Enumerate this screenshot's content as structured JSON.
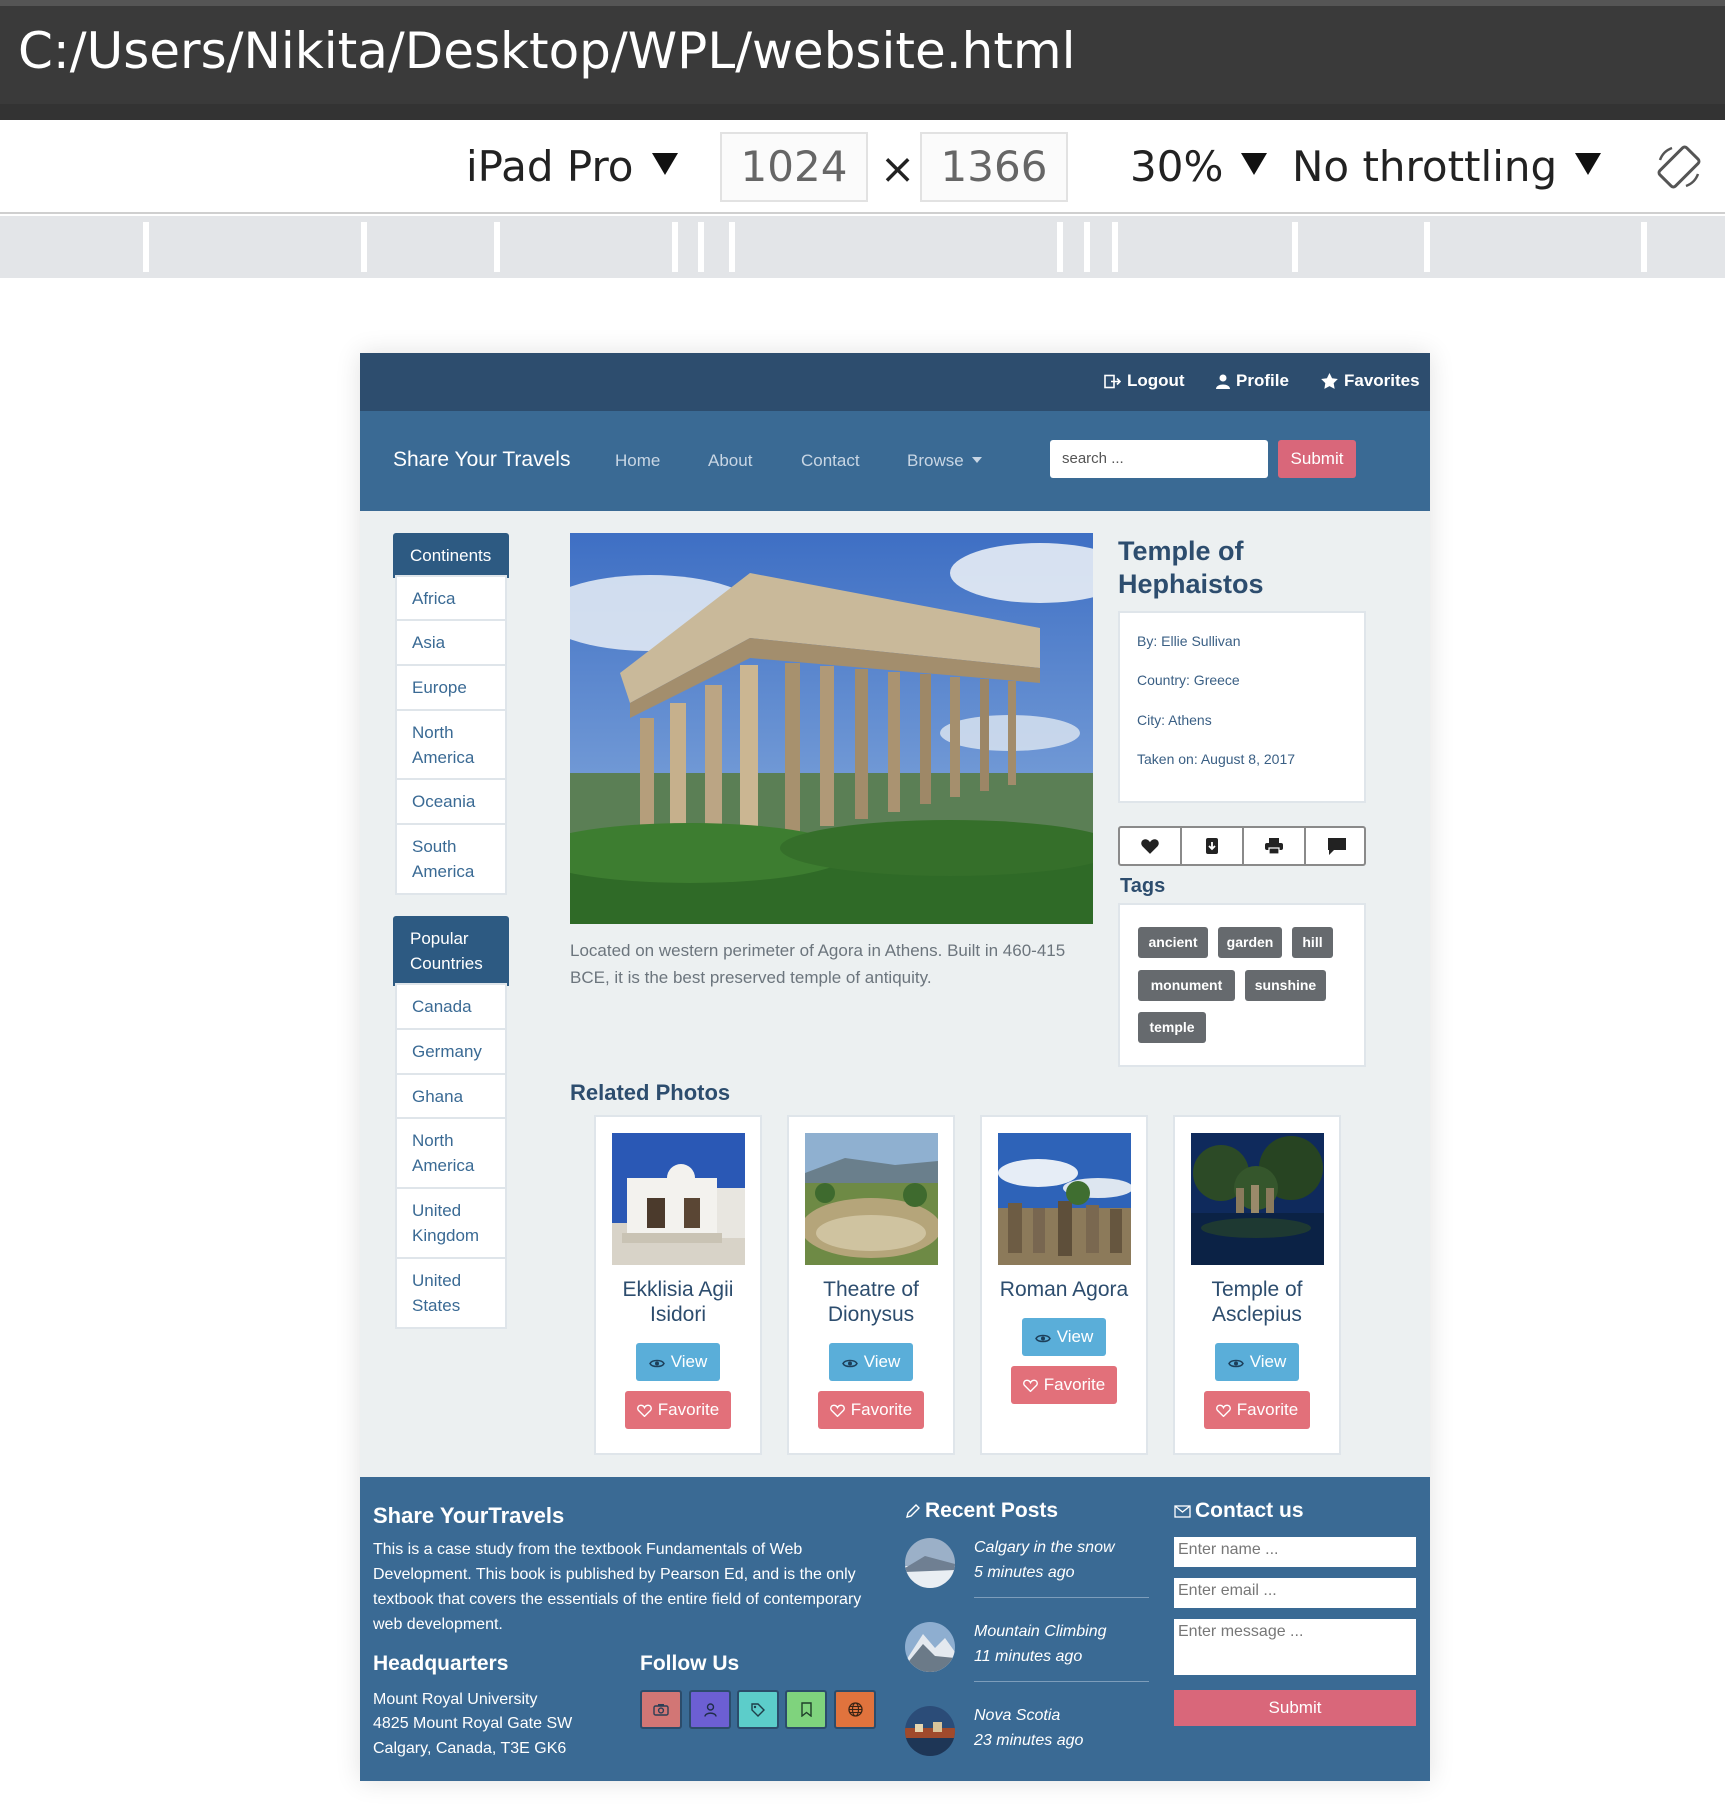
{
  "window": {
    "path": "C:/Users/Nikita/Desktop/WPL/website.html"
  },
  "devtools": {
    "device": "iPad Pro",
    "width": "1024",
    "times": "×",
    "height": "1366",
    "zoom": "30%",
    "throttling": "No throttling"
  },
  "site": {
    "topbar": {
      "logout": "Logout",
      "profile": "Profile",
      "favorites": "Favorites"
    },
    "nav": {
      "brand": "Share Your Travels",
      "items": [
        "Home",
        "About",
        "Contact",
        "Browse"
      ],
      "search_placeholder": "search ...",
      "submit": "Submit"
    },
    "sidebar": {
      "continents_title": "Continents",
      "continents": [
        "Africa",
        "Asia",
        "Europe",
        "North America",
        "Oceania",
        "South America"
      ],
      "popular_title": "Popular Countries",
      "popular": [
        "Canada",
        "Germany",
        "Ghana",
        "North America",
        "United Kingdom",
        "United States"
      ]
    },
    "photo": {
      "title": "Temple of Hephaistos",
      "caption": "Located on western perimeter of Agora in Athens. Built in 460-415 BCE, it is the best preserved temple of antiquity.",
      "by": "By: Ellie Sullivan",
      "country": "Country: Greece",
      "city": "City: Athens",
      "taken": "Taken on: August 8, 2017"
    },
    "tags_title": "Tags",
    "tags": [
      "ancient",
      "garden",
      "hill",
      "monument",
      "sunshine",
      "temple"
    ],
    "related_title": "Related Photos",
    "related": [
      {
        "name": "Ekklisia Agii Isidori",
        "view": "View",
        "favorite": "Favorite"
      },
      {
        "name": "Theatre of Dionysus",
        "view": "View",
        "favorite": "Favorite"
      },
      {
        "name": "Roman Agora",
        "view": "View",
        "favorite": "Favorite"
      },
      {
        "name": "Temple of Asclepius",
        "view": "View",
        "favorite": "Favorite"
      }
    ],
    "footer": {
      "about_title": "Share YourTravels",
      "about_text": "This is a case study from the textbook Fundamentals of Web Development. This book is published by Pearson Ed, and is the only textbook that covers the essentials of the entire field of contemporary web development.",
      "hq_title": "Headquarters",
      "hq_lines": [
        "Mount Royal University",
        "4825 Mount Royal Gate SW",
        "Calgary, Canada, T3E GK6"
      ],
      "follow_title": "Follow Us",
      "social_icons": [
        "camera-icon",
        "user-icon",
        "tag-icon",
        "bookmark-icon",
        "globe-icon"
      ],
      "social_colors": [
        "#d27675",
        "#6c5fd3",
        "#5ccdca",
        "#7fd37d",
        "#e0733d"
      ],
      "recent_title": "Recent Posts",
      "posts": [
        {
          "title": "Calgary in the snow",
          "time": "5 minutes ago"
        },
        {
          "title": "Mountain Climbing",
          "time": "11 minutes ago"
        },
        {
          "title": "Nova Scotia",
          "time": "23 minutes ago"
        }
      ],
      "contact_title": "Contact us",
      "name_placeholder": "Enter name ...",
      "email_placeholder": "Enter email ...",
      "message_placeholder": "Enter message ...",
      "submit": "Submit"
    }
  },
  "colors": {
    "topbar": "#2d4d6e",
    "navbar": "#3a6a94",
    "accent_pink": "#d9677a",
    "view_blue": "#5aaed9"
  }
}
